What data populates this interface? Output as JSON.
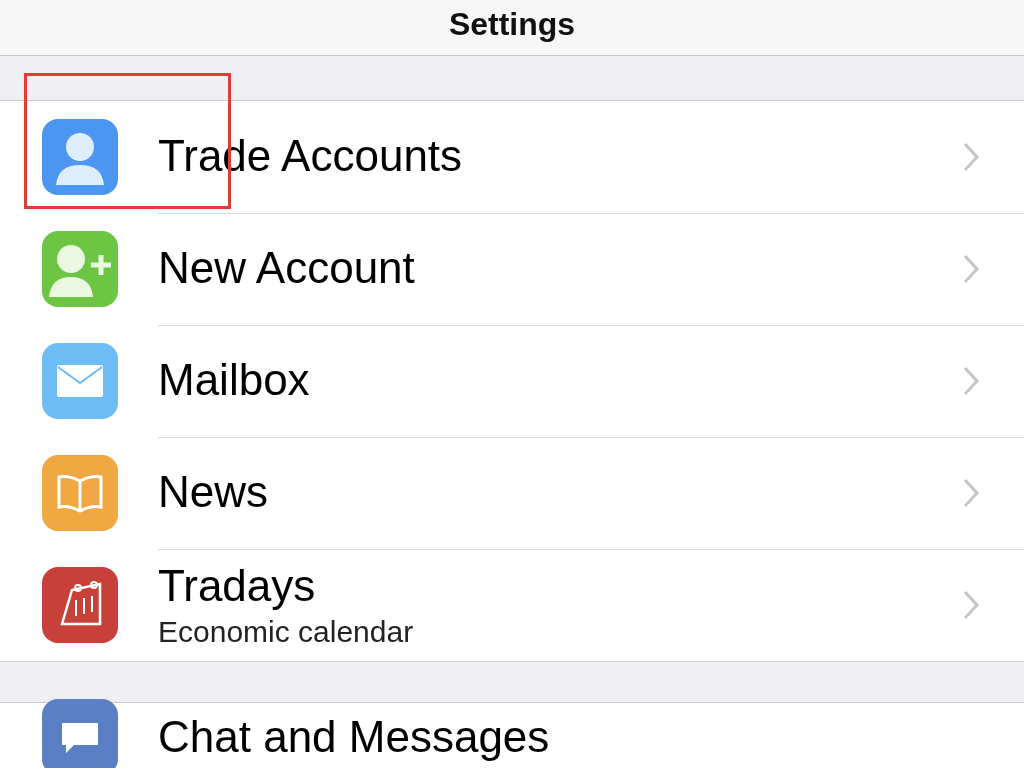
{
  "header": {
    "title": "Settings"
  },
  "groups": [
    {
      "items": [
        {
          "kind": "person",
          "label": "Trade Accounts",
          "color": "#4a96f0",
          "highlighted": true
        },
        {
          "kind": "add-person",
          "label": "New Account",
          "color": "#6cc644",
          "highlighted": false
        },
        {
          "kind": "mail",
          "label": "Mailbox",
          "color": "#6ebcf5",
          "highlighted": false
        },
        {
          "kind": "book",
          "label": "News",
          "color": "#f0a843",
          "highlighted": false
        },
        {
          "kind": "calendar",
          "label": "Tradays",
          "subtitle": "Economic calendar",
          "color": "#c8403a",
          "highlighted": false
        }
      ]
    },
    {
      "items": [
        {
          "kind": "chat",
          "label": "Chat and Messages",
          "color": "#5b7fc4",
          "highlighted": false
        }
      ]
    }
  ]
}
